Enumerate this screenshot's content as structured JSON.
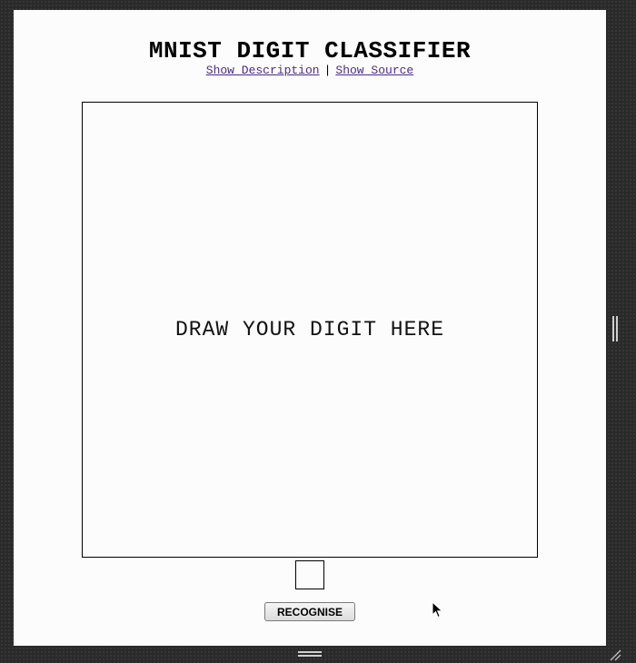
{
  "page": {
    "title": "MNIST DIGIT CLASSIFIER",
    "links": {
      "description": "Show Description",
      "separator": "|",
      "source": "Show Source"
    }
  },
  "canvas": {
    "hint": "DRAW YOUR DIGIT HERE"
  },
  "actions": {
    "recognise_label": "RECOGNISE"
  },
  "colors": {
    "page_background": "#fcfcfc",
    "outer_background": "#2a2a2a",
    "link": "#4b2a8c",
    "border": "#000000"
  },
  "icons": {
    "cursor": "mouse-pointer-icon",
    "right_handle": "vertical-resize-handle-icon",
    "bottom_handle": "horizontal-resize-handle-icon",
    "corner": "resize-grip-icon"
  }
}
